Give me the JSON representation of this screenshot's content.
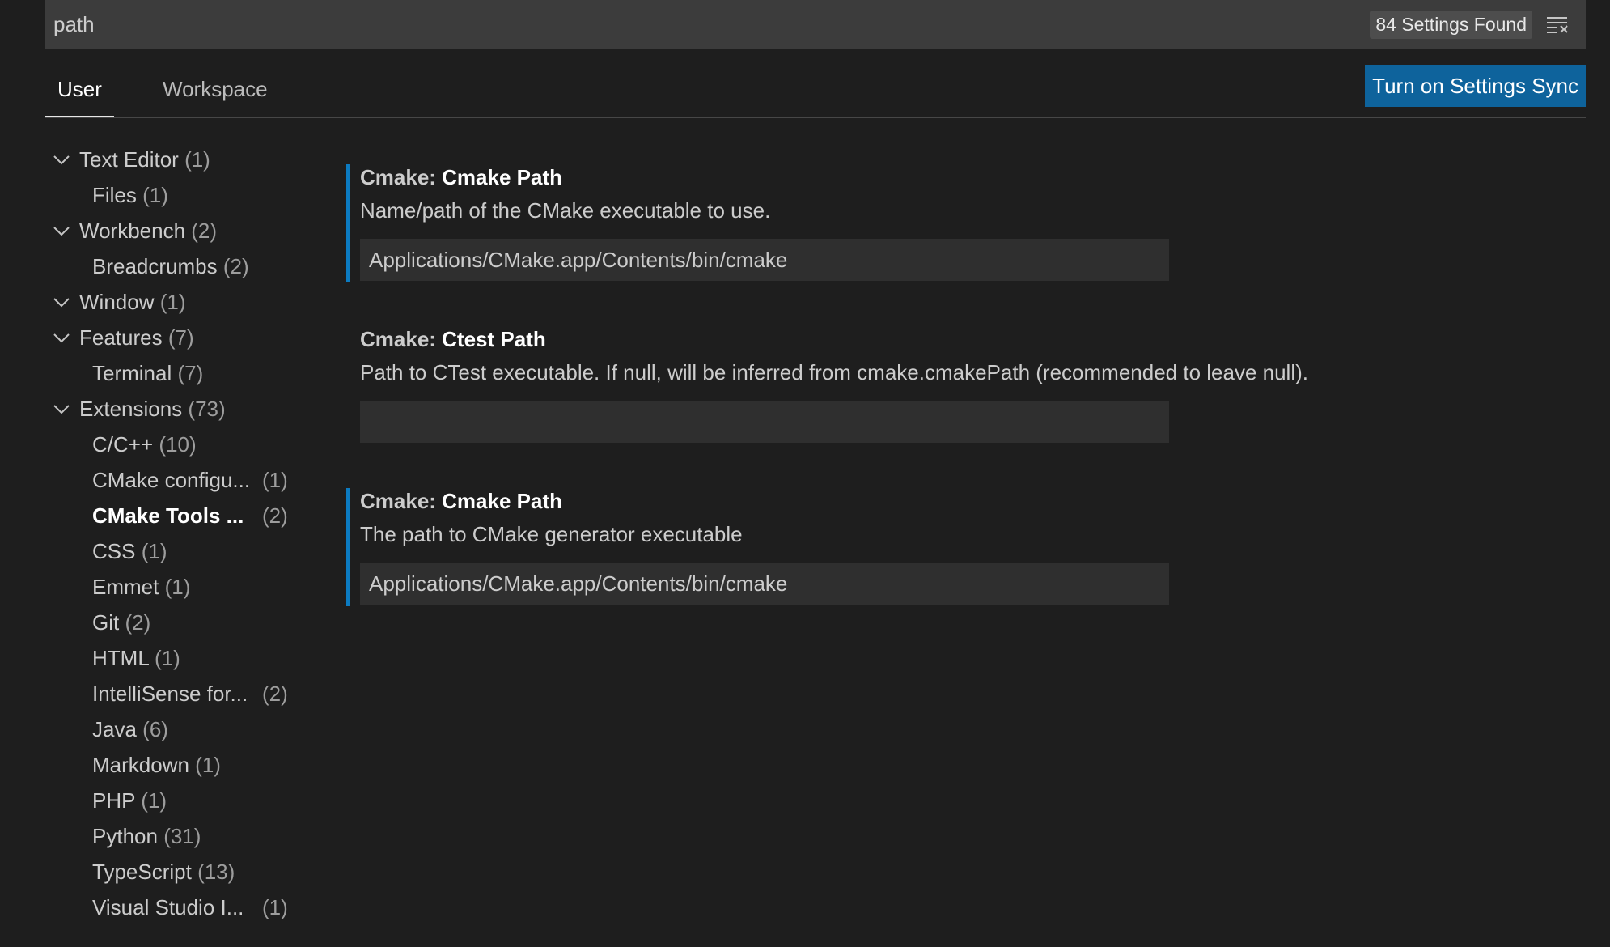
{
  "search": {
    "value": "path",
    "results_count": "84 Settings Found"
  },
  "tabs": [
    {
      "label": "User",
      "active": true
    },
    {
      "label": "Workspace",
      "active": false
    }
  ],
  "sync_button_label": "Turn on Settings Sync",
  "toc": [
    {
      "label": "Text Editor",
      "count": "(1)",
      "level": 0,
      "expanded": true
    },
    {
      "label": "Files",
      "count": "(1)",
      "level": 1
    },
    {
      "label": "Workbench",
      "count": "(2)",
      "level": 0,
      "expanded": true
    },
    {
      "label": "Breadcrumbs",
      "count": "(2)",
      "level": 1
    },
    {
      "label": "Window",
      "count": "(1)",
      "level": 0,
      "expanded": true
    },
    {
      "label": "Features",
      "count": "(7)",
      "level": 0,
      "expanded": true
    },
    {
      "label": "Terminal",
      "count": "(7)",
      "level": 1
    },
    {
      "label": "Extensions",
      "count": "(73)",
      "level": 0,
      "expanded": true
    },
    {
      "label": "C/C++",
      "count": "(10)",
      "level": 1
    },
    {
      "label": "CMake configu...",
      "count": "(1)",
      "level": 1,
      "truncated": true
    },
    {
      "label": "CMake Tools ...",
      "count": "(2)",
      "level": 1,
      "truncated": true,
      "selected": true
    },
    {
      "label": "CSS",
      "count": "(1)",
      "level": 1
    },
    {
      "label": "Emmet",
      "count": "(1)",
      "level": 1
    },
    {
      "label": "Git",
      "count": "(2)",
      "level": 1
    },
    {
      "label": "HTML",
      "count": "(1)",
      "level": 1
    },
    {
      "label": "IntelliSense for...",
      "count": "(2)",
      "level": 1,
      "truncated": true
    },
    {
      "label": "Java",
      "count": "(6)",
      "level": 1
    },
    {
      "label": "Markdown",
      "count": "(1)",
      "level": 1
    },
    {
      "label": "PHP",
      "count": "(1)",
      "level": 1
    },
    {
      "label": "Python",
      "count": "(31)",
      "level": 1
    },
    {
      "label": "TypeScript",
      "count": "(13)",
      "level": 1
    },
    {
      "label": "Visual Studio I...",
      "count": "(1)",
      "level": 1,
      "truncated": true
    }
  ],
  "settings": [
    {
      "category": "Cmake: ",
      "name": "Cmake Path",
      "description": "Name/path of the CMake executable to use.",
      "value": "Applications/CMake.app/Contents/bin/cmake",
      "modified": true
    },
    {
      "category": "Cmake: ",
      "name": "Ctest Path",
      "description": "Path to CTest executable. If null, will be inferred from cmake.cmakePath (recommended to leave null).",
      "value": "",
      "modified": false
    },
    {
      "category": "Cmake: ",
      "name": "Cmake Path",
      "description": "The path to CMake generator executable",
      "value": "Applications/CMake.app/Contents/bin/cmake",
      "modified": true
    }
  ],
  "colors": {
    "background": "#1e1e1e",
    "search_bg": "#3c3c3c",
    "accent": "#0e639c",
    "modified_indicator": "#0c7bc1"
  }
}
